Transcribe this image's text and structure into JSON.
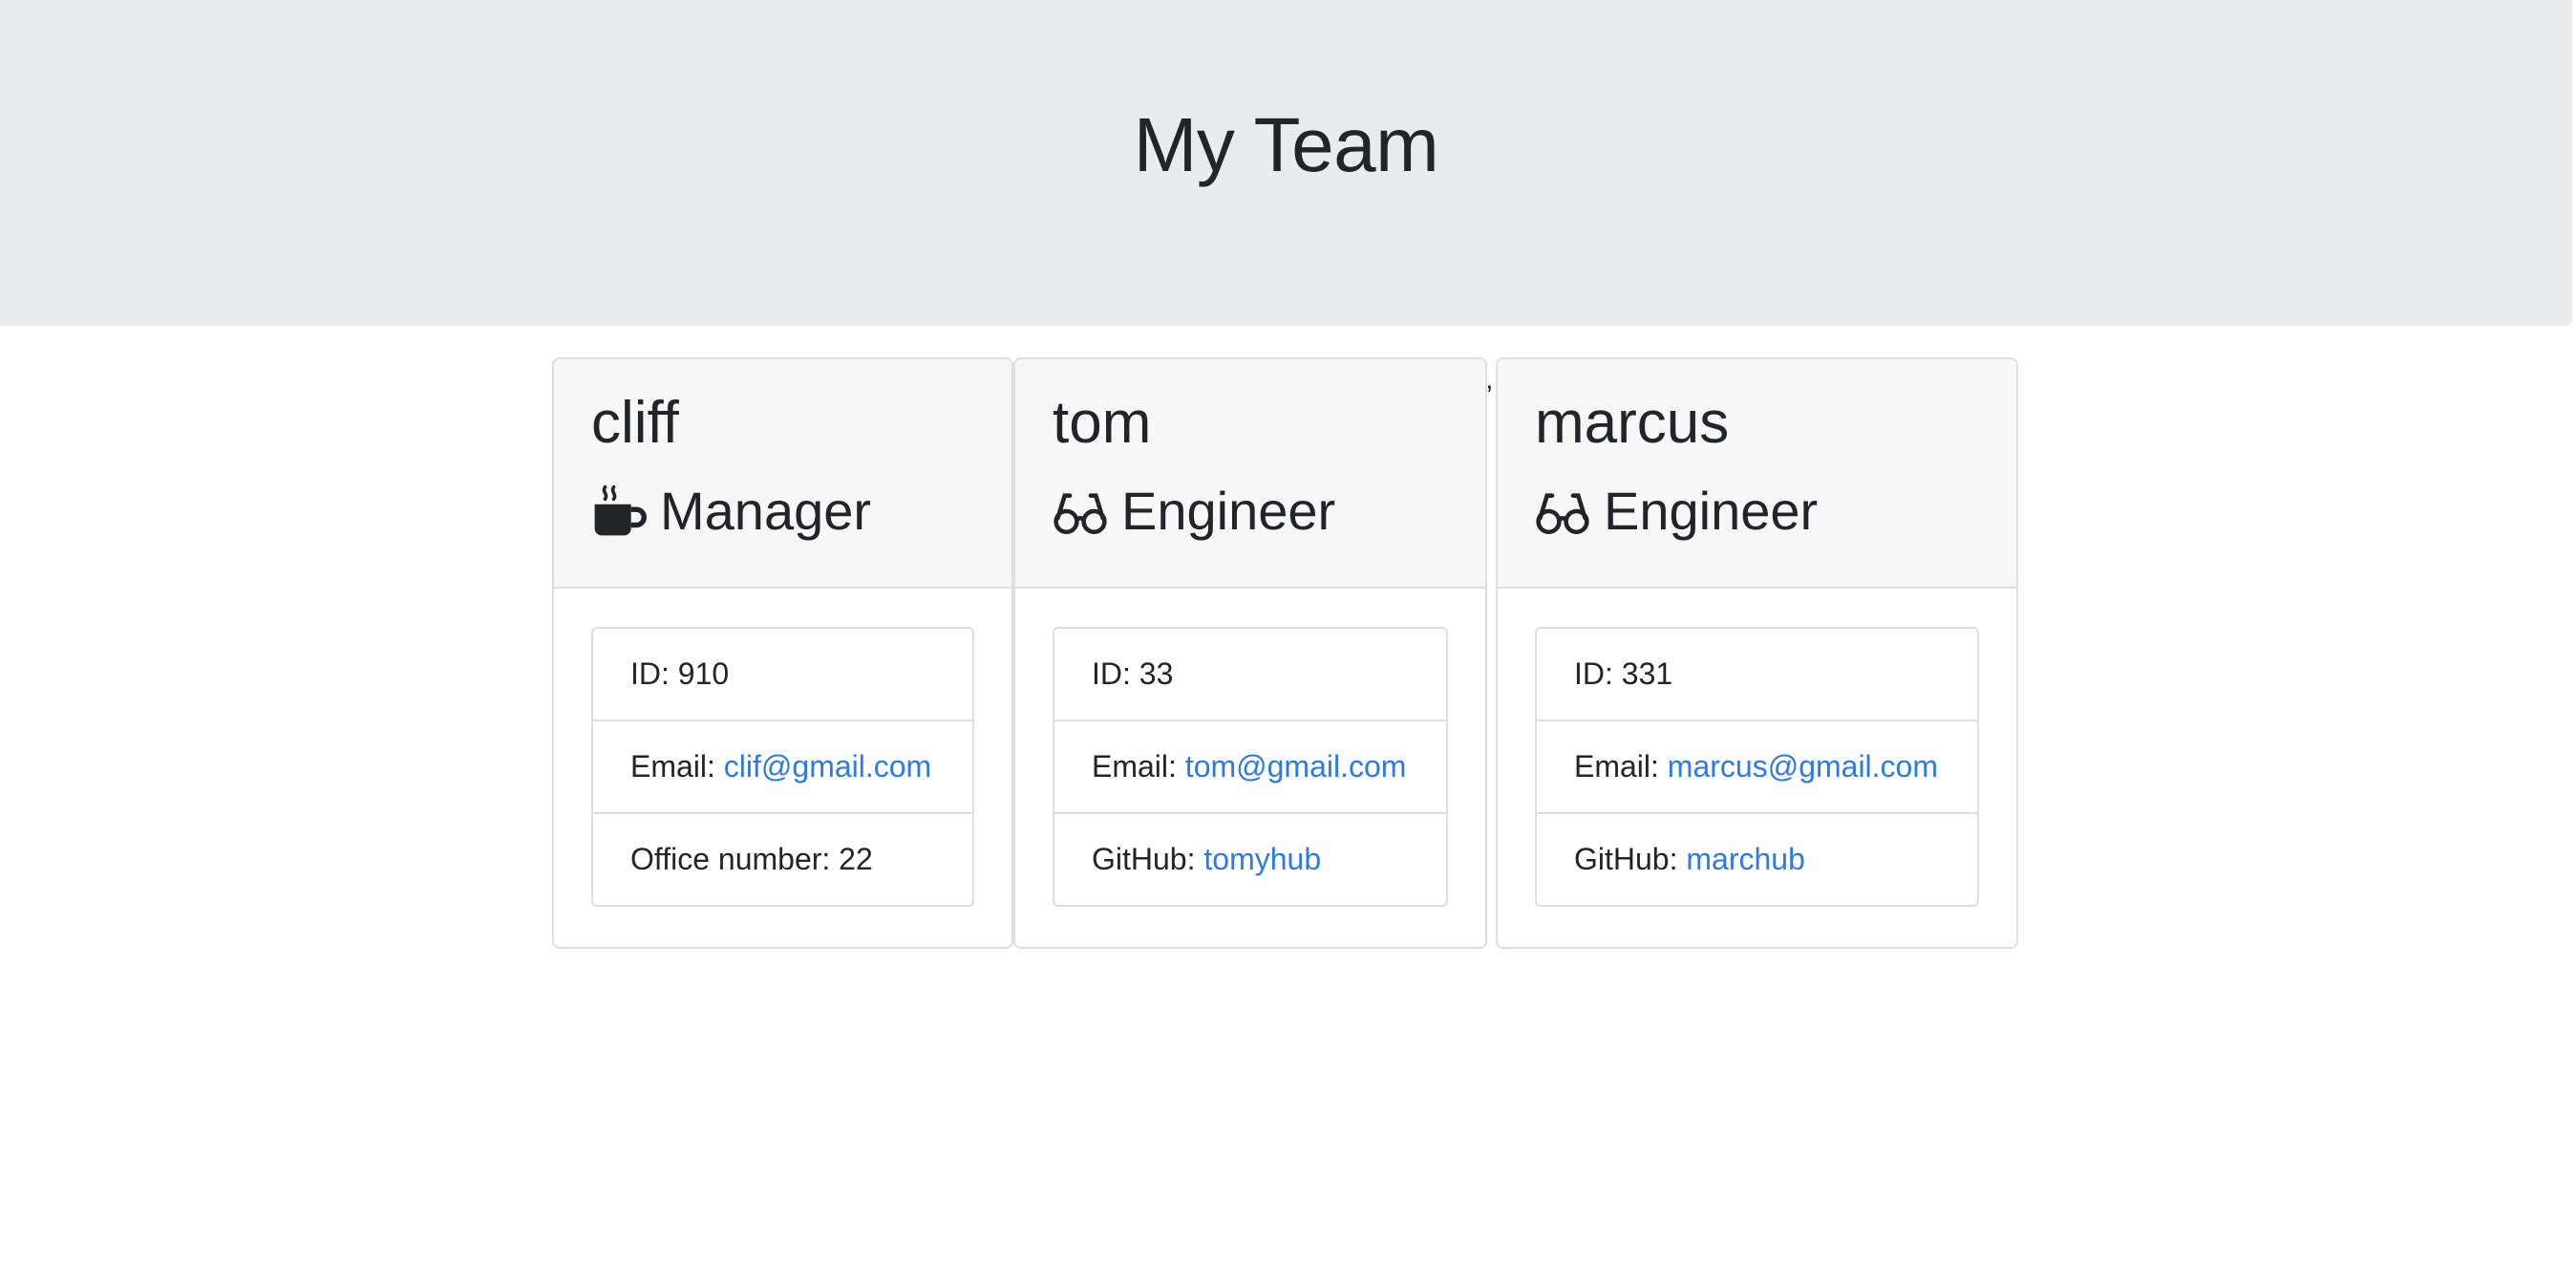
{
  "header": {
    "title": "My Team"
  },
  "employees": [
    {
      "name": "cliff",
      "role": "Manager",
      "role_icon": "coffee-mug-icon",
      "id_label": "ID: 910",
      "email_prefix": "Email: ",
      "email": "clif@gmail.com",
      "extra_prefix": "Office number: 22",
      "extra_value": ""
    },
    {
      "name": "tom",
      "role": "Engineer",
      "role_icon": "glasses-icon",
      "id_label": "ID: 33",
      "email_prefix": "Email: ",
      "email": "tom@gmail.com",
      "extra_prefix": "GitHub: ",
      "extra_value": "tomyhub"
    },
    {
      "name": "marcus",
      "role": "Engineer",
      "role_icon": "glasses-icon",
      "id_label": "ID: 331",
      "email_prefix": "Email: ",
      "email": "marcus@gmail.com",
      "extra_prefix": "GitHub: ",
      "extra_value": "marchub"
    }
  ],
  "stray_mark": "’",
  "colors": {
    "header_bg": "#e9ecef",
    "card_header_bg": "#f7f7f7",
    "link": "#2c7be5",
    "text": "#212529",
    "border": "#dcdfe2"
  }
}
